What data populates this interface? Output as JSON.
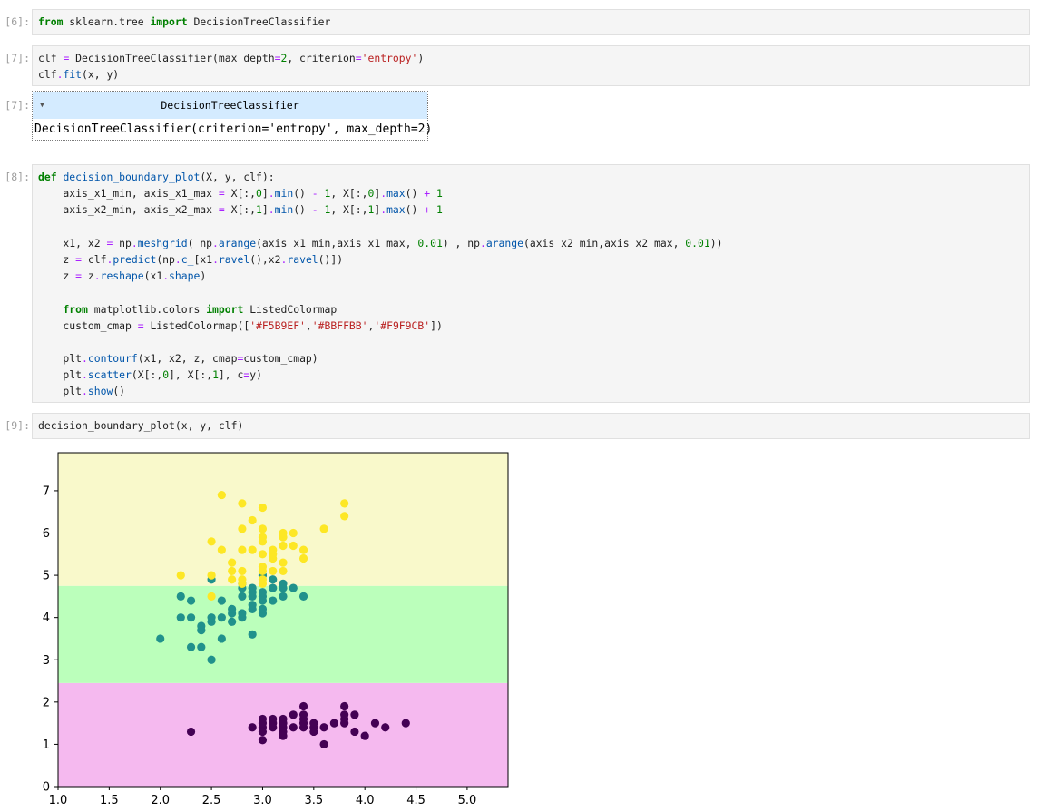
{
  "cells": [
    {
      "prompt": "[6]:",
      "lines": [
        "from sklearn.tree import DecisionTreeClassifier"
      ]
    },
    {
      "prompt": "[7]:",
      "lines": [
        "clf = DecisionTreeClassifier(max_depth=2, criterion='entropy')",
        "clf.fit(x, y)"
      ]
    },
    {
      "prompt": "[7]:",
      "output_title": "DecisionTreeClassifier",
      "output_text": "DecisionTreeClassifier(criterion='entropy', max_depth=2)"
    },
    {
      "prompt": "[8]:",
      "lines": [
        "def decision_boundary_plot(X, y, clf):",
        "    axis_x1_min, axis_x1_max = X[:,0].min() - 1, X[:,0].max() + 1",
        "    axis_x2_min, axis_x2_max = X[:,1].min() - 1, X[:,1].max() + 1",
        "",
        "    x1, x2 = np.meshgrid( np.arange(axis_x1_min,axis_x1_max, 0.01) , np.arange(axis_x2_min,axis_x2_max, 0.01))",
        "    z = clf.predict(np.c_[x1.ravel(),x2.ravel()])",
        "    z = z.reshape(x1.shape)",
        "",
        "    from matplotlib.colors import ListedColormap",
        "    custom_cmap = ListedColormap(['#F5B9EF','#BBFFBB','#F9F9CB'])",
        "",
        "    plt.contourf(x1, x2, z, cmap=custom_cmap)",
        "    plt.scatter(X[:,0], X[:,1], c=y)",
        "    plt.show()"
      ]
    },
    {
      "prompt": "[9]:",
      "lines": [
        "decision_boundary_plot(x, y, clf)"
      ]
    }
  ],
  "chart_data": {
    "type": "scatter",
    "xlim": [
      1.0,
      5.4
    ],
    "ylim": [
      0,
      7.9
    ],
    "xticks": [
      "1.0",
      "1.5",
      "2.0",
      "2.5",
      "3.0",
      "3.5",
      "4.0",
      "4.5",
      "5.0"
    ],
    "yticks": [
      "0",
      "1",
      "2",
      "3",
      "4",
      "5",
      "6",
      "7"
    ],
    "regions": [
      {
        "y_from": 0,
        "y_to": 2.45,
        "color": "#F5B9EF"
      },
      {
        "y_from": 2.45,
        "y_to": 4.75,
        "color": "#BBFFBB"
      },
      {
        "y_from": 4.75,
        "y_to": 7.9,
        "color": "#F9F9CB"
      }
    ],
    "series": [
      {
        "color": "#440154",
        "points": [
          [
            2.3,
            1.3
          ],
          [
            2.9,
            1.4
          ],
          [
            3.0,
            1.4
          ],
          [
            3.0,
            1.6
          ],
          [
            3.0,
            1.3
          ],
          [
            3.0,
            1.1
          ],
          [
            3.0,
            1.5
          ],
          [
            3.1,
            1.5
          ],
          [
            3.1,
            1.6
          ],
          [
            3.1,
            1.4
          ],
          [
            3.2,
            1.3
          ],
          [
            3.2,
            1.2
          ],
          [
            3.2,
            1.4
          ],
          [
            3.2,
            1.6
          ],
          [
            3.2,
            1.5
          ],
          [
            3.3,
            1.7
          ],
          [
            3.3,
            1.4
          ],
          [
            3.4,
            1.4
          ],
          [
            3.4,
            1.5
          ],
          [
            3.4,
            1.6
          ],
          [
            3.4,
            1.7
          ],
          [
            3.4,
            1.9
          ],
          [
            3.5,
            1.4
          ],
          [
            3.5,
            1.3
          ],
          [
            3.5,
            1.5
          ],
          [
            3.6,
            1.4
          ],
          [
            3.6,
            1.0
          ],
          [
            3.7,
            1.5
          ],
          [
            3.8,
            1.6
          ],
          [
            3.8,
            1.9
          ],
          [
            3.8,
            1.7
          ],
          [
            3.8,
            1.5
          ],
          [
            3.9,
            1.3
          ],
          [
            3.9,
            1.7
          ],
          [
            4.0,
            1.2
          ],
          [
            4.1,
            1.5
          ],
          [
            4.2,
            1.4
          ],
          [
            4.4,
            1.5
          ]
        ]
      },
      {
        "color": "#21918c",
        "points": [
          [
            2.0,
            3.5
          ],
          [
            2.2,
            4.0
          ],
          [
            2.2,
            4.5
          ],
          [
            2.3,
            4.0
          ],
          [
            2.3,
            3.3
          ],
          [
            2.3,
            4.4
          ],
          [
            2.4,
            3.3
          ],
          [
            2.4,
            3.7
          ],
          [
            2.4,
            3.8
          ],
          [
            2.5,
            3.0
          ],
          [
            2.5,
            3.9
          ],
          [
            2.5,
            4.0
          ],
          [
            2.5,
            4.9
          ],
          [
            2.6,
            3.5
          ],
          [
            2.6,
            4.0
          ],
          [
            2.6,
            4.4
          ],
          [
            2.7,
            3.9
          ],
          [
            2.7,
            4.1
          ],
          [
            2.7,
            4.2
          ],
          [
            2.8,
            4.0
          ],
          [
            2.8,
            4.1
          ],
          [
            2.8,
            4.5
          ],
          [
            2.8,
            4.7
          ],
          [
            2.8,
            4.8
          ],
          [
            2.9,
            3.6
          ],
          [
            2.9,
            4.2
          ],
          [
            2.9,
            4.3
          ],
          [
            2.9,
            4.5
          ],
          [
            2.9,
            4.6
          ],
          [
            2.9,
            4.7
          ],
          [
            3.0,
            4.1
          ],
          [
            3.0,
            4.2
          ],
          [
            3.0,
            4.4
          ],
          [
            3.0,
            4.5
          ],
          [
            3.0,
            4.6
          ],
          [
            3.0,
            5.0
          ],
          [
            3.1,
            4.4
          ],
          [
            3.1,
            4.7
          ],
          [
            3.1,
            4.9
          ],
          [
            3.2,
            4.5
          ],
          [
            3.2,
            4.7
          ],
          [
            3.2,
            4.8
          ],
          [
            3.3,
            4.7
          ],
          [
            3.4,
            4.5
          ]
        ]
      },
      {
        "color": "#fde725",
        "points": [
          [
            2.2,
            5.0
          ],
          [
            2.5,
            4.5
          ],
          [
            2.5,
            5.0
          ],
          [
            2.5,
            5.8
          ],
          [
            2.6,
            5.6
          ],
          [
            2.6,
            6.9
          ],
          [
            2.7,
            4.9
          ],
          [
            2.7,
            5.1
          ],
          [
            2.7,
            5.3
          ],
          [
            2.8,
            4.8
          ],
          [
            2.8,
            4.9
          ],
          [
            2.8,
            5.1
          ],
          [
            2.8,
            5.6
          ],
          [
            2.8,
            6.1
          ],
          [
            2.8,
            6.7
          ],
          [
            2.9,
            5.6
          ],
          [
            2.9,
            6.3
          ],
          [
            3.0,
            4.8
          ],
          [
            3.0,
            4.9
          ],
          [
            3.0,
            5.1
          ],
          [
            3.0,
            5.2
          ],
          [
            3.0,
            5.5
          ],
          [
            3.0,
            5.8
          ],
          [
            3.0,
            5.9
          ],
          [
            3.0,
            6.1
          ],
          [
            3.0,
            6.6
          ],
          [
            3.1,
            5.1
          ],
          [
            3.1,
            5.4
          ],
          [
            3.1,
            5.5
          ],
          [
            3.1,
            5.6
          ],
          [
            3.2,
            5.1
          ],
          [
            3.2,
            5.3
          ],
          [
            3.2,
            5.7
          ],
          [
            3.2,
            5.9
          ],
          [
            3.2,
            6.0
          ],
          [
            3.3,
            5.7
          ],
          [
            3.3,
            6.0
          ],
          [
            3.4,
            5.4
          ],
          [
            3.4,
            5.6
          ],
          [
            3.6,
            6.1
          ],
          [
            3.8,
            6.4
          ],
          [
            3.8,
            6.7
          ]
        ]
      }
    ]
  }
}
